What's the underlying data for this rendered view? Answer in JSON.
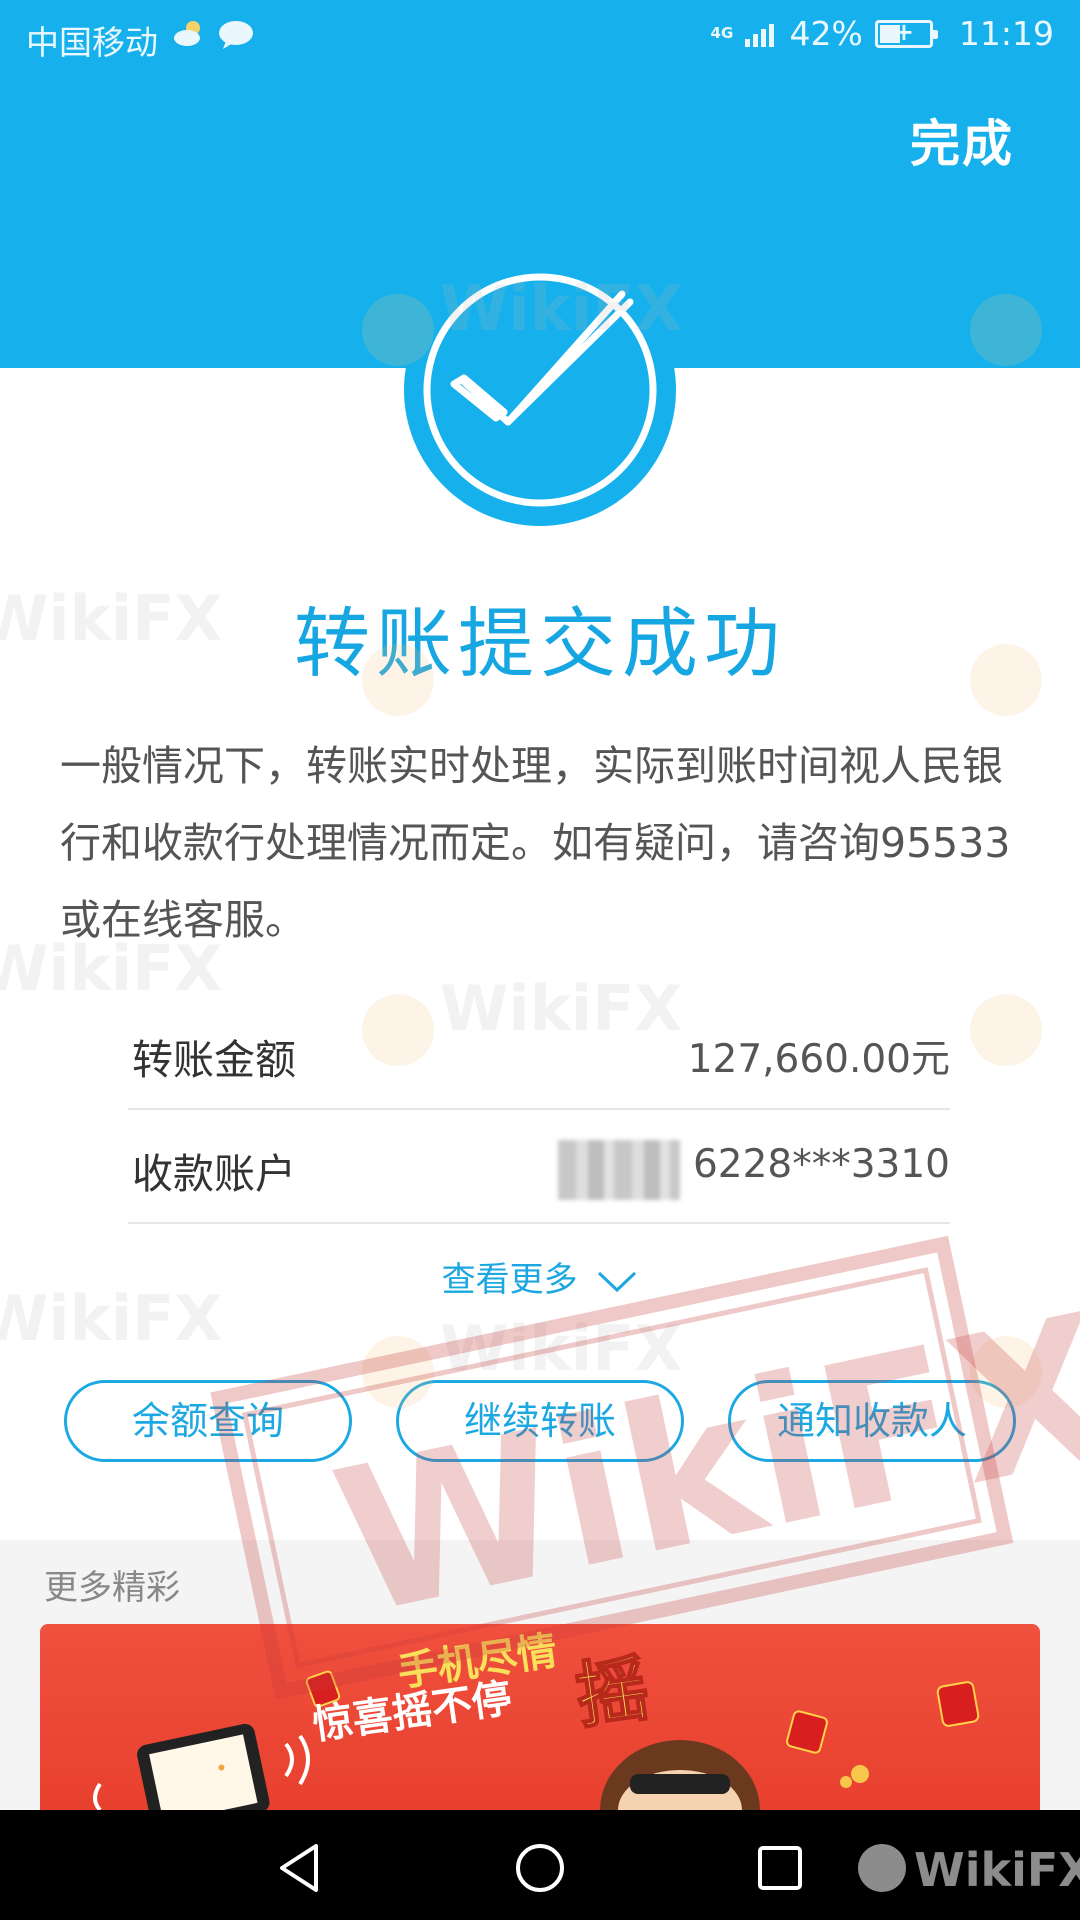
{
  "status_bar": {
    "carrier": "中国移动",
    "network": "4G",
    "battery": "42%",
    "time": "11:19"
  },
  "header": {
    "done_label": "完成"
  },
  "result": {
    "title": "转账提交成功",
    "description": "一般情况下，转账实时处理，实际到账时间视人民银行和收款行处理情况而定。如有疑问，请咨询95533或在线客服。"
  },
  "details": {
    "amount_label": "转账金额",
    "amount_value": "127,660.00元",
    "account_label": "收款账户",
    "account_value": "6228***3310"
  },
  "more_link": "查看更多",
  "actions": {
    "balance": "余额查询",
    "continue": "继续转账",
    "notify": "通知收款人"
  },
  "more_section": {
    "title": "更多精彩",
    "banner_line1": "手机尽情",
    "banner_line2": "惊喜摇不停",
    "banner_big": "摇"
  },
  "watermark": {
    "brand": "WikiFX",
    "stamp": "WikiFX"
  },
  "colors": {
    "primary": "#16b1ec",
    "accent_text": "#16a6e2",
    "banner": "#e8402f",
    "nav": "#000000"
  },
  "icons": [
    "weather-icon",
    "chat-icon",
    "signal-icon",
    "battery-icon",
    "check-icon",
    "chevron-down-icon",
    "back-icon",
    "home-icon",
    "recent-apps-icon"
  ]
}
